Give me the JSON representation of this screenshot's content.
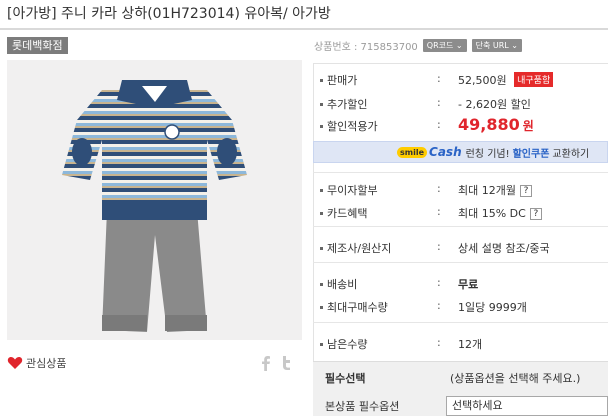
{
  "title": "[아가방] 주니 카라 상하(01H723014) 유아복/ 아가방",
  "store_tag": "롯데백화점",
  "product_number": {
    "label": "상품번호 : 715853700",
    "qr_button": "QR코드 ⌄",
    "short_url_button": "단축 URL ⌄"
  },
  "price": {
    "sale_label": "판매가",
    "sale_value": "52,500원",
    "sale_badge": "내구품함",
    "extra_discount_label": "추가할인",
    "extra_discount_value": "- 2,620원 할인",
    "final_label": "할인적용가",
    "final_value": "49,880",
    "final_unit": "원"
  },
  "cash_banner": {
    "smile": "smile",
    "cash": "Cash",
    "text1": "런칭 기념!",
    "strong": "할인쿠폰",
    "text2": "교환하기"
  },
  "payment": {
    "installment_label": "무이자할부",
    "installment_value": "최대 12개월",
    "card_label": "카드혜택",
    "card_value": "최대 15% DC",
    "qmark": "?"
  },
  "maker": {
    "label": "제조사/원산지",
    "value": "상세 설명 참조/중국"
  },
  "shipping": {
    "fee_label": "배송비",
    "fee_value": "무료",
    "max_label": "최대구매수량",
    "max_value": "1일당 9999개"
  },
  "stock": {
    "label": "남은수량",
    "value": "12개"
  },
  "options": {
    "required_label": "필수선택",
    "required_text": "(상품옵션을 선택해 주세요.)",
    "main_label": "본상품 필수옵션",
    "select_value": "선택하세요"
  },
  "like_label": "관심상품",
  "colon": ":",
  "colors": {
    "accent_red": "#e0252c",
    "badge_red": "#e52a2a",
    "cash_blue": "#2a63c6",
    "banner_bg": "#dfe6f5"
  }
}
